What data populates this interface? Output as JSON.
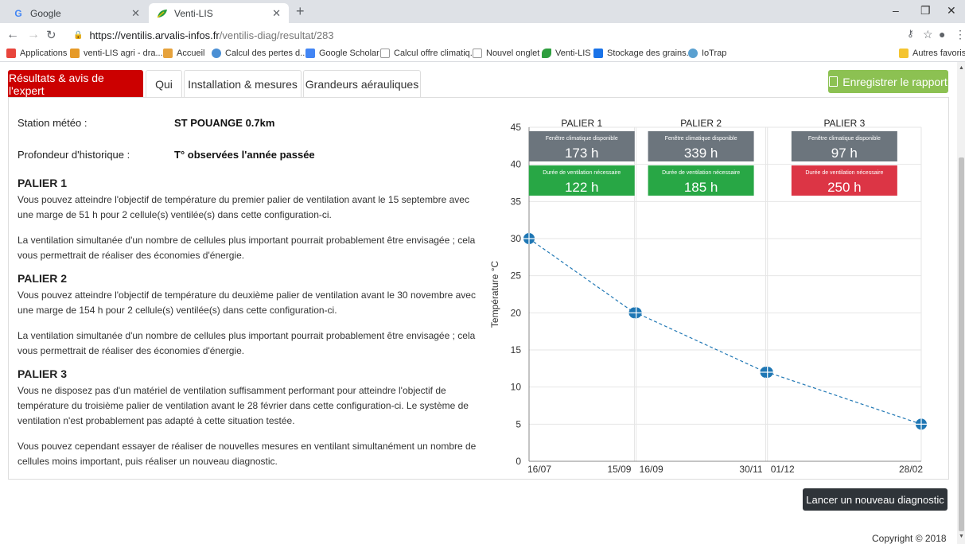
{
  "browser": {
    "tabs": [
      {
        "title": "Google",
        "icon": "google-favicon",
        "color": "#4285f4"
      },
      {
        "title": "Venti-LIS",
        "icon": "leaf-favicon",
        "color": "#2e9e3e"
      }
    ],
    "url_host": "https://ventilis.arvalis-infos.fr",
    "url_path": "/ventilis-diag/resultat/283",
    "bookmarks": [
      {
        "label": "Applications",
        "color": "#e8453c"
      },
      {
        "label": "venti-LIS agri - dra...",
        "color": "#e69a28"
      },
      {
        "label": "Accueil",
        "color": "#e6a23c"
      },
      {
        "label": "Calcul des pertes d...",
        "color": "#4a8fd4"
      },
      {
        "label": "Google Scholar",
        "color": "#4285f4"
      },
      {
        "label": "Calcul offre climatiq...",
        "color": "#aaaaaa"
      },
      {
        "label": "Nouvel onglet",
        "color": "#aaaaaa"
      },
      {
        "label": "Venti-LIS",
        "color": "#2e9e3e"
      },
      {
        "label": "Stockage des grains...",
        "color": "#1a73e8"
      },
      {
        "label": "IoTrap",
        "color": "#5aa0d0"
      }
    ],
    "other_bookmarks": "Autres favoris"
  },
  "nav": {
    "tabs": [
      "Résultats & avis de l'expert",
      "Qui",
      "Installation & mesures",
      "Grandeurs aérauliques"
    ],
    "save_label": "Enregistrer le rapport"
  },
  "info": {
    "station_label": "Station météo :",
    "station_value": "ST POUANGE 0.7km",
    "history_label": "Profondeur d'historique :",
    "history_value": "T° observées l'année passée"
  },
  "paliers": [
    {
      "title": "PALIER 1",
      "text1": "Vous pouvez atteindre l'objectif de température du premier palier de ventilation avant le 15 septembre avec une marge de 51 h pour 2 cellule(s) ventilée(s) dans cette configuration-ci.",
      "text2": "La ventilation simultanée d'un nombre de cellules plus important pourrait probablement être envisagée ; cela vous permettrait de réaliser des économies d'énergie."
    },
    {
      "title": "PALIER 2",
      "text1": "Vous pouvez atteindre l'objectif de température du deuxième palier de ventilation avant le 30 novembre avec une marge de 154 h pour 2 cellule(s) ventilée(s) dans cette configuration-ci.",
      "text2": "La ventilation simultanée d'un nombre de cellules plus important pourrait probablement être envisagée ; cela vous permettrait de réaliser des économies d'énergie."
    },
    {
      "title": "PALIER 3",
      "text1": "Vous ne disposez pas d'un matériel de ventilation suffisamment performant pour atteindre l'objectif de température du troisième palier de ventilation avant le 28 février dans cette configuration-ci. Le système de ventilation n'est probablement pas adapté à cette situation testée.",
      "text2": "Vous pouvez cependant essayer de réaliser de nouvelles mesures en ventilant simultanément un nombre de cellules moins important, puis réaliser un nouveau diagnostic."
    }
  ],
  "chart_data": {
    "type": "line",
    "ylabel": "Température °C",
    "ylim": [
      0,
      45
    ],
    "yticks": [
      0,
      5,
      10,
      15,
      20,
      25,
      30,
      35,
      40,
      45
    ],
    "x": [
      "16/07",
      "15/09",
      "16/09",
      "30/11",
      "01/12",
      "28/02"
    ],
    "x_days": [
      0,
      61,
      62,
      137,
      138,
      227
    ],
    "y": [
      30,
      20,
      20,
      12,
      12,
      5
    ],
    "line_color": "#1f77b4",
    "line_style": "dashed",
    "paliers": [
      {
        "name": "PALIER 1",
        "start": "16/07",
        "end": "15/09",
        "fenetre_label": "Fenêtre climatique disponible",
        "fenetre": "173 h",
        "duree_label": "Durée de ventilation nécessaire",
        "duree": "122 h",
        "duree_color": "#28a745"
      },
      {
        "name": "PALIER 2",
        "start": "16/09",
        "end": "30/11",
        "fenetre_label": "Fenêtre climatique disponible",
        "fenetre": "339 h",
        "duree_label": "Durée de ventilation nécessaire",
        "duree": "185 h",
        "duree_color": "#28a745"
      },
      {
        "name": "PALIER 3",
        "start": "01/12",
        "end": "28/02",
        "fenetre_label": "Fenêtre climatique disponible",
        "fenetre": "97 h",
        "duree_label": "Durée de ventilation nécessaire",
        "duree": "250 h",
        "duree_color": "#dc3545"
      }
    ],
    "fenetre_color": "#6c757d"
  },
  "footer": {
    "new_diag_label": "Lancer un nouveau diagnostic",
    "copyright": "Copyright © 2018"
  }
}
